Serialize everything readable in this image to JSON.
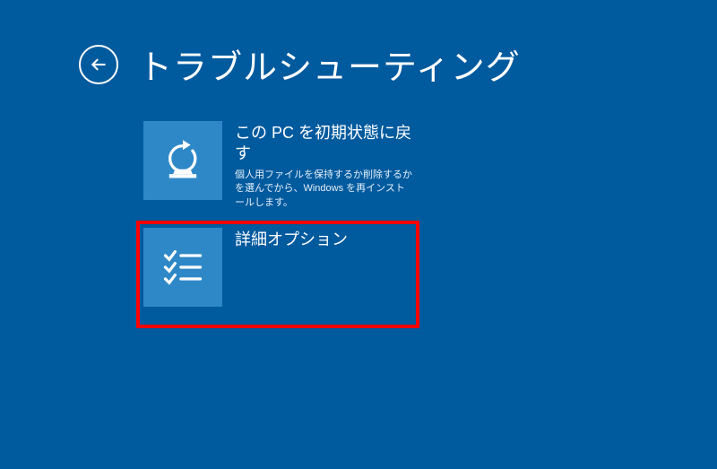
{
  "header": {
    "title": "トラブルシューティング"
  },
  "options": {
    "reset": {
      "title": "この PC を初期状態に戻す",
      "desc": "個人用ファイルを保持するか削除するかを選んでから、Windows を再インストールします。"
    },
    "advanced": {
      "title": "詳細オプション"
    }
  }
}
